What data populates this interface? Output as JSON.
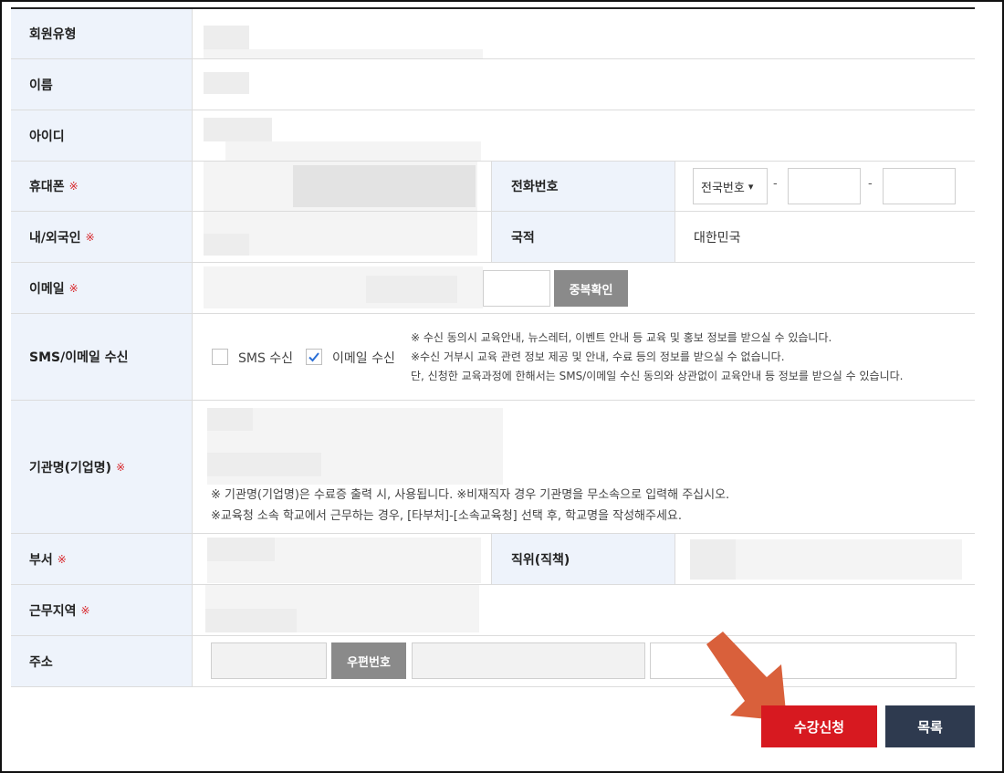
{
  "rows": {
    "member_type": {
      "label": "회원유형"
    },
    "name": {
      "label": "이름"
    },
    "user_id": {
      "label": "아이디"
    },
    "mobile": {
      "label": "휴대폰",
      "required": "※"
    },
    "phone": {
      "label": "전화번호",
      "select_value": "전국번호",
      "separator": "-"
    },
    "nationality_type": {
      "label": "내/외국인",
      "required": "※"
    },
    "country": {
      "label": "국적",
      "value": "대한민국"
    },
    "email": {
      "label": "이메일",
      "required": "※",
      "check_button": "중복확인"
    },
    "sms_email": {
      "label": "SMS/이메일 수신",
      "sms_label": "SMS 수신",
      "email_label": "이메일 수신",
      "sms_checked": false,
      "email_checked": true,
      "notes": [
        "※ 수신 동의시 교육안내, 뉴스레터, 이벤트 안내 등 교육 및 홍보 정보를 받으실 수 있습니다.",
        "※수신 거부시 교육 관련 정보 제공 및 안내, 수료 등의 정보를 받으실 수 없습니다.",
        "단, 신청한 교육과정에 한해서는 SMS/이메일 수신 동의와 상관없이 교육안내 등 정보를 받으실 수 있습니다."
      ]
    },
    "organization": {
      "label": "기관명(기업명)",
      "required": "※",
      "notes": [
        "※ 기관명(기업명)은 수료증 출력 시, 사용됩니다. ※비재직자 경우 기관명을 무소속으로 입력해 주십시오.",
        "※교육청 소속 학교에서 근무하는 경우, [타부처]-[소속교육청] 선택 후, 학교명을 작성해주세요."
      ]
    },
    "department": {
      "label": "부서",
      "required": "※"
    },
    "position": {
      "label": "직위(직책)"
    },
    "work_region": {
      "label": "근무지역",
      "required": "※"
    },
    "address": {
      "label": "주소",
      "zip_button": "우편번호"
    }
  },
  "actions": {
    "apply": "수강신청",
    "list": "목록"
  },
  "colors": {
    "header_bg": "#eef3fb",
    "apply_btn": "#d71920",
    "list_btn": "#2e3a4f",
    "arrow": "#d9603b",
    "required": "#d8262b"
  }
}
